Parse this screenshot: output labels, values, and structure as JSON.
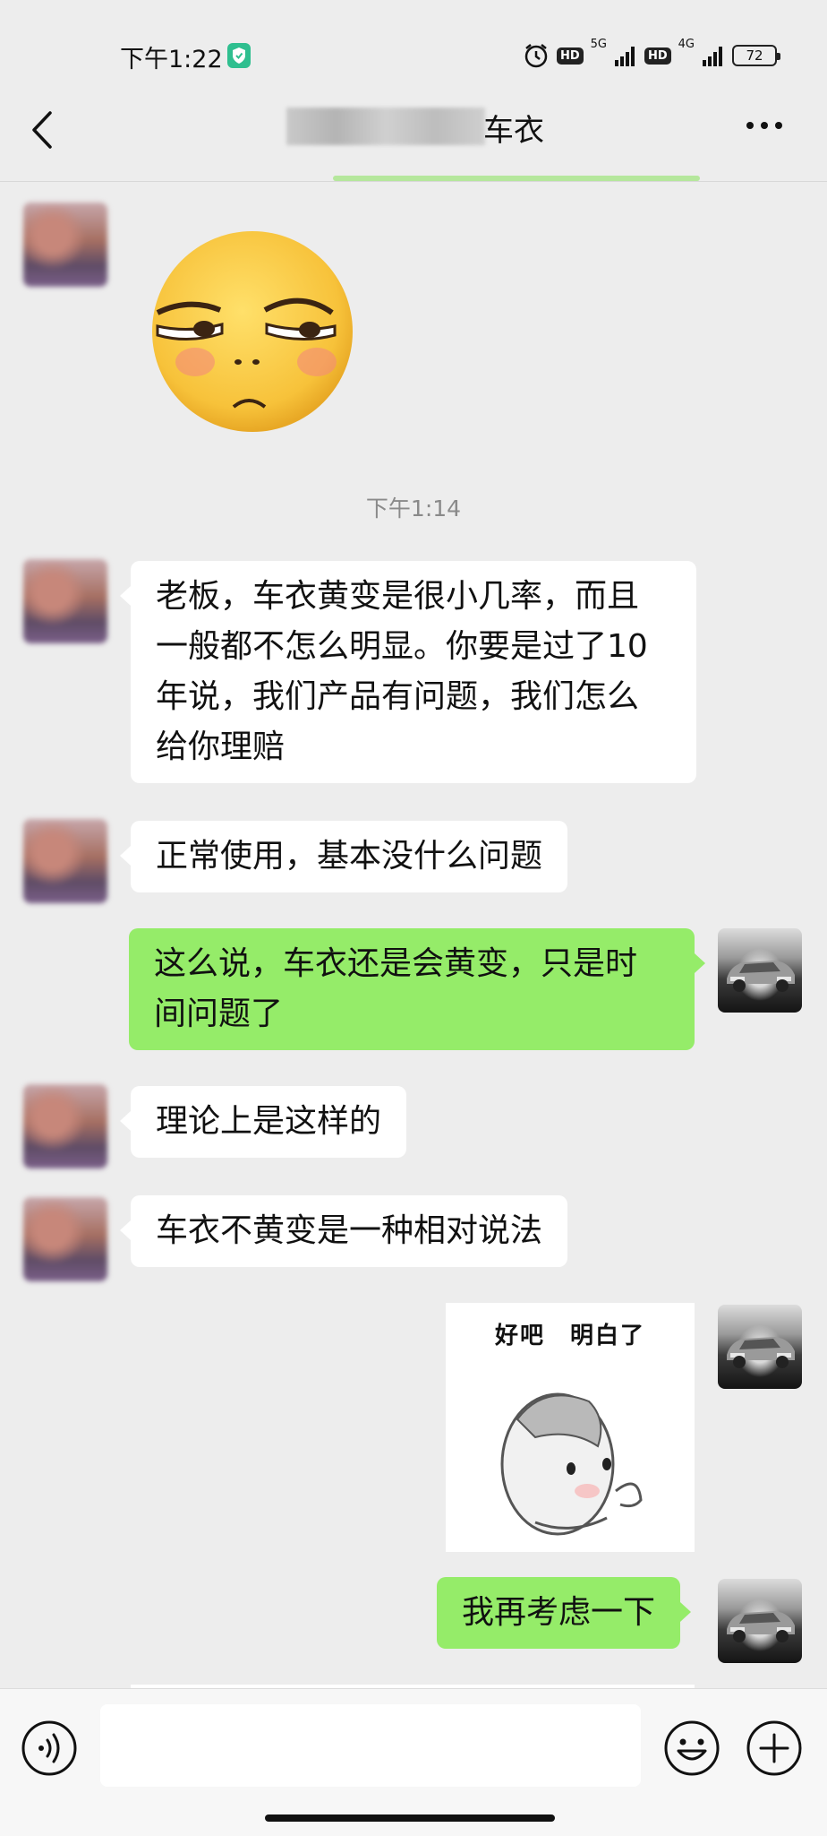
{
  "status_bar": {
    "time": "下午1:22",
    "hd_badge": "HD",
    "network_5g": "5G",
    "network_4g": "4G",
    "battery": "72"
  },
  "header": {
    "title_visible": "车衣"
  },
  "chat": {
    "timestamp": "下午1:14",
    "messages": [
      {
        "from": "other",
        "type": "sticker",
        "sticker": "smirking-face-emoji"
      },
      {
        "from": "other",
        "type": "text",
        "lines": [
          "老板，车衣黄变是很小几率，而且",
          "一般都不怎么明显。你要是过了10",
          "年说，我们产品有问题，我们怎么",
          "给你理赔"
        ]
      },
      {
        "from": "other",
        "type": "text",
        "text": "正常使用，基本没什么问题"
      },
      {
        "from": "me",
        "type": "text",
        "lines": [
          "这么说，车衣还是会黄变，只是时",
          "间问题了"
        ]
      },
      {
        "from": "other",
        "type": "text",
        "text": "理论上是这样的"
      },
      {
        "from": "other",
        "type": "text",
        "text": "车衣不黄变是一种相对说法"
      },
      {
        "from": "me",
        "type": "sticker",
        "caption": "好吧　明白了",
        "sticker": "hamster-sticker"
      },
      {
        "from": "me",
        "type": "text",
        "text": "我再考虑一下"
      }
    ]
  },
  "input_bar": {
    "placeholder": "",
    "icons": [
      "voice-icon",
      "emoji-icon",
      "plus-icon"
    ]
  },
  "colors": {
    "background": "#ededed",
    "outgoing_bubble": "#95ec69",
    "incoming_bubble": "#ffffff"
  }
}
